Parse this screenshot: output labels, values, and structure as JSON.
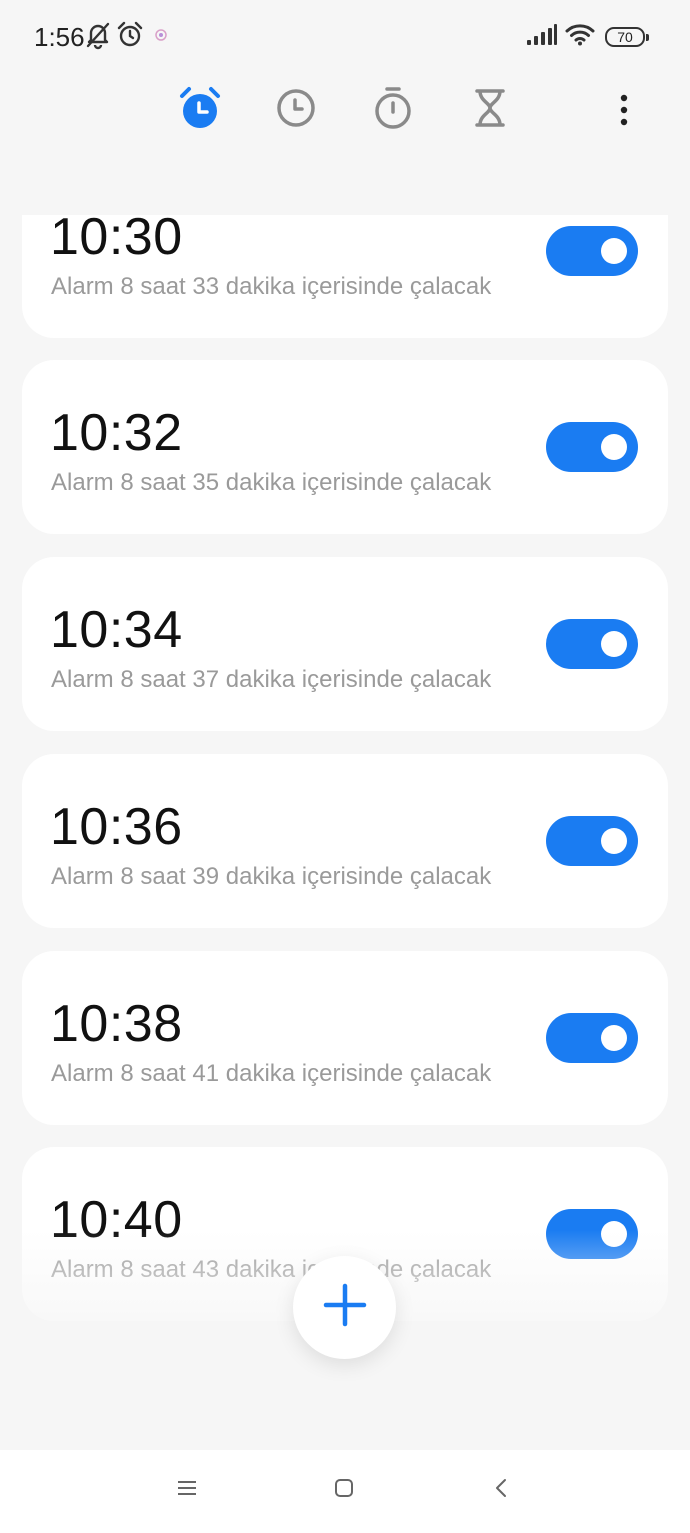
{
  "status_bar": {
    "time": "1:56",
    "battery": "70",
    "icons": [
      "bell-off-icon",
      "alarm-icon",
      "notification-dot-icon",
      "signal-icon",
      "wifi-icon",
      "battery-icon"
    ]
  },
  "top_nav": {
    "tabs": [
      {
        "name": "alarm",
        "icon": "alarm-clock-icon",
        "active": true
      },
      {
        "name": "world-clock",
        "icon": "clock-icon",
        "active": false
      },
      {
        "name": "stopwatch",
        "icon": "stopwatch-icon",
        "active": false
      },
      {
        "name": "timer",
        "icon": "hourglass-icon",
        "active": false
      }
    ],
    "more_icon": "more-vertical-icon"
  },
  "alarms": [
    {
      "time": "10:30",
      "subtitle": "Alarm 8 saat 33 dakika içerisinde çalacak",
      "enabled": true
    },
    {
      "time": "10:32",
      "subtitle": "Alarm 8 saat 35 dakika içerisinde çalacak",
      "enabled": true
    },
    {
      "time": "10:34",
      "subtitle": "Alarm 8 saat 37 dakika içerisinde çalacak",
      "enabled": true
    },
    {
      "time": "10:36",
      "subtitle": "Alarm 8 saat 39 dakika içerisinde çalacak",
      "enabled": true
    },
    {
      "time": "10:38",
      "subtitle": "Alarm 8 saat 41 dakika içerisinde çalacak",
      "enabled": true
    },
    {
      "time": "10:40",
      "subtitle": "Alarm 8 saat 43 dakika içerisinde çalacak",
      "enabled": true
    }
  ],
  "fab_icon": "plus-icon",
  "bottom_nav": {
    "icons": [
      "menu-icon",
      "home-square-icon",
      "back-chevron-icon"
    ]
  },
  "colors": {
    "accent": "#1a7cf2",
    "background": "#f6f6f6",
    "card": "#ffffff",
    "subtitle": "#9a9a9a",
    "icon_inactive": "#8a8a8a"
  }
}
